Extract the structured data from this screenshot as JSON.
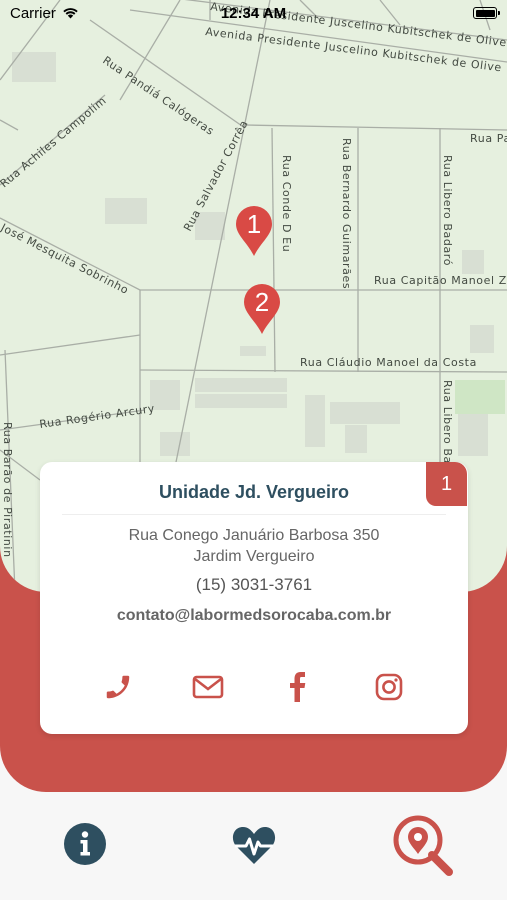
{
  "status_bar": {
    "carrier": "Carrier",
    "time": "12:34 AM"
  },
  "map": {
    "streets": {
      "avenida_1": "Avenida Presidente Juscelino Kubitschek de Oliveira",
      "avenida_2": "Avenida Presidente Juscelino Kubitschek de Olive",
      "rua_pandia": "Rua Pandiá Calógeras",
      "rua_achiles": "Rua Achiles Campolim",
      "rua_salvador": "Rua Salvador Corrêa",
      "rua_conde": "Rua Conde D Eu",
      "rua_bernardo": "Rua Bernardo Guimarães",
      "rua_libero_1": "Rua Libero Badaró",
      "rua_libero_2": "Rua Libero Ba",
      "rua_pa": "Rua Pa",
      "rua_jose": "José Mesquita Sobrinho",
      "rua_capitao": "Rua Capitão Manoel Z",
      "rua_claudio": "Rua Cláudio Manoel da Costa",
      "rua_rogerio": "Rua Rogério Arcury",
      "rua_barao": "Rua Barão de Piratinin"
    },
    "markers": [
      {
        "label": "1"
      },
      {
        "label": "2"
      }
    ]
  },
  "card": {
    "badge": "1",
    "title": "Unidade Jd. Vergueiro",
    "address_line1": "Rua Conego Januário Barbosa 350",
    "address_line2": "Jardim Vergueiro",
    "phone": "(15) 3031-3761",
    "email": "contato@labormedsorocaba.com.br",
    "actions": [
      {
        "icon": "phone-icon"
      },
      {
        "icon": "envelope-icon"
      },
      {
        "icon": "facebook-icon"
      },
      {
        "icon": "instagram-icon"
      }
    ]
  },
  "tabs": [
    {
      "icon": "info-icon",
      "active": false
    },
    {
      "icon": "heartbeat-icon",
      "active": false
    },
    {
      "icon": "location-search-icon",
      "active": true
    }
  ],
  "colors": {
    "accent": "#c9524b",
    "dark": "#2e4f60",
    "map_bg": "#e6f0df",
    "road": "#a9aea6"
  }
}
